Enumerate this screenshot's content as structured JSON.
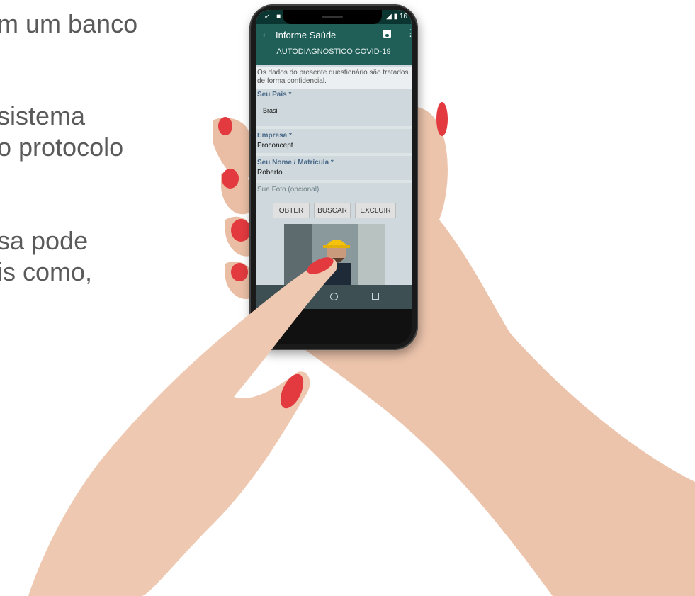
{
  "slide": {
    "lines": [
      "m um banco",
      "sistema",
      "o protocolo",
      "sa pode",
      "is como,"
    ]
  },
  "status_bar": {
    "left_icons": "↙ ■ ▮",
    "right_text": "◢ ▮ 16"
  },
  "app": {
    "back_icon": "arrow-left-icon",
    "title": "Informe Saúde",
    "subtitle": "AUTODIAGNOSTICO COVID-19",
    "notice": "Os dados do presente questionário são tratados de forma confidencial."
  },
  "form": {
    "pais_label": "Seu País *",
    "pais_value": "Brasil",
    "empresa_label": "Empresa *",
    "empresa_value": "Proconcept",
    "nome_label": "Seu Nome / Matrícula *",
    "nome_value": "Roberto",
    "foto_label": "Sua Foto (opcional)",
    "btn_obter": "OBTER",
    "btn_buscar": "BUSCAR",
    "btn_excluir": "EXCLUIR"
  },
  "colors": {
    "appbar": "#1f5f58",
    "statusbar": "#0b3530",
    "form_bg": "#cfd8dc",
    "label_color": "#4a6a8a",
    "nail_color": "#e23a3f"
  }
}
